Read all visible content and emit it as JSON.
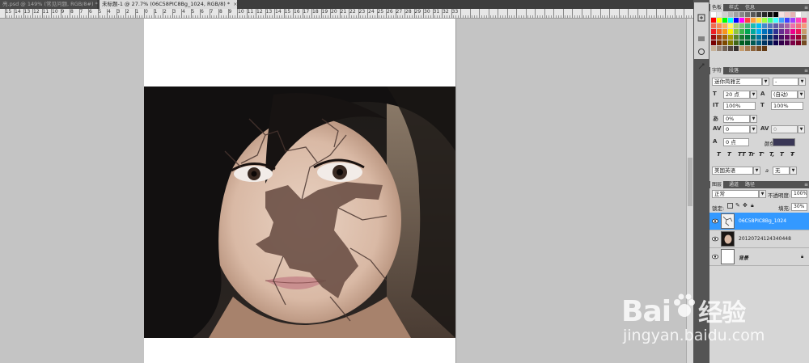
{
  "tabs": [
    {
      "label": "亮.psd @ 149% (常见问题, RGB/8#) *"
    },
    {
      "label": "未标题-1 @ 27.7% (06C58PIC8Bg_1024, RGB/8) *"
    }
  ],
  "ruler": {
    "numbers": [
      "0",
      "1",
      "2",
      "3",
      "4",
      "5",
      "6",
      "7",
      "8",
      "9",
      "10",
      "11",
      "12",
      "13",
      "14",
      "15",
      "16",
      "17",
      "18",
      "19",
      "20",
      "21",
      "22",
      "23",
      "24",
      "25",
      "26",
      "27",
      "28",
      "29",
      "30",
      "31",
      "32",
      "33"
    ]
  },
  "swatches_panel": {
    "tabs": [
      "色板",
      "样式",
      "信息"
    ]
  },
  "char_panel": {
    "tabs": [
      "字符",
      "段落"
    ],
    "font_family": "迷你简雅艺",
    "font_style": "-",
    "size": "20 点",
    "leading": "(自动)",
    "vscale": "100%",
    "hscale": "100%",
    "tsume": "0%",
    "kerning": "0",
    "tracking": "0",
    "baseline": "0 点",
    "color_label": "颜色:",
    "text_color": "#3a3756",
    "style_buttons": [
      "T",
      "T",
      "TT",
      "Tr",
      "T'",
      "T,",
      "T",
      "Ŧ"
    ],
    "language": "美国英语",
    "aa_label": "a",
    "antialias": "无"
  },
  "layers_panel": {
    "tabs": [
      "图层",
      "通道",
      "路径"
    ],
    "blend_mode": "正常",
    "opacity_label": "不透明度:",
    "opacity": "100%",
    "lock_label": "锁定:",
    "fill_label": "填充:",
    "fill": "30%",
    "layers": [
      {
        "name": "06C58PIC8Bg_1024",
        "selected": true
      },
      {
        "name": "20120724124340448",
        "selected": false
      },
      {
        "name": "背景",
        "selected": false
      }
    ]
  },
  "watermark": {
    "brand": "Bai",
    "brand_tail": "经验",
    "site": "jingyan.baidu.com"
  },
  "colors": {
    "selection": "#3399ff",
    "canvas_bg": "#c4c4c4",
    "panel_bg": "#d6d6d6"
  }
}
